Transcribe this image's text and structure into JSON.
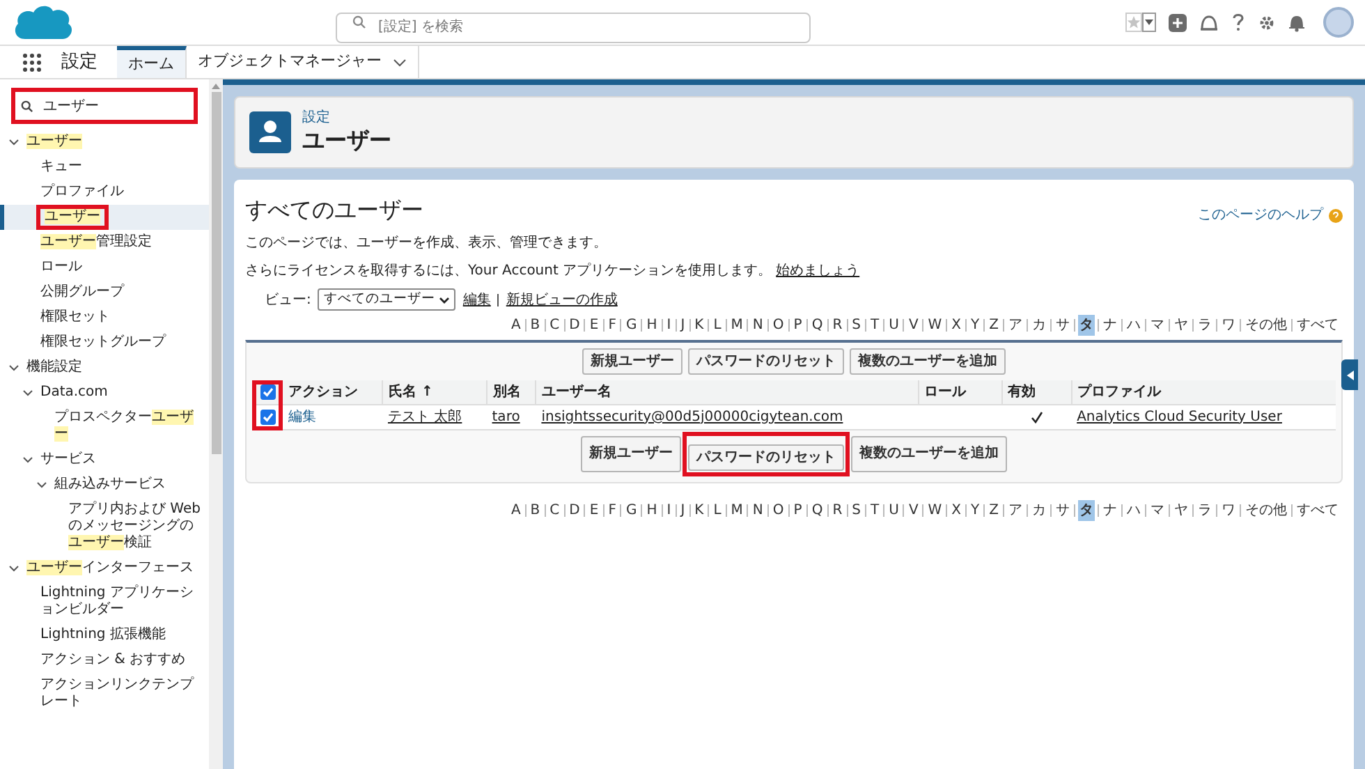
{
  "header": {
    "search": {
      "placeholder": "[設定] を検索"
    }
  },
  "nav": {
    "app_name": "設定",
    "tabs": [
      {
        "label": "ホーム",
        "selected": true,
        "dropdown": false
      },
      {
        "label": "オブジェクトマネージャー",
        "selected": false,
        "dropdown": true
      }
    ]
  },
  "sidebar": {
    "search": {
      "value": "ユーザー",
      "annotated": true
    },
    "items": [
      {
        "parts": [
          {
            "text": "ユーザー",
            "match": true
          }
        ],
        "expanded": true,
        "children": [
          {
            "parts": [
              {
                "text": "キュー",
                "match": false
              }
            ],
            "selected": false,
            "annotated": false
          },
          {
            "parts": [
              {
                "text": "プロファイル",
                "match": false
              }
            ],
            "selected": false,
            "annotated": false
          },
          {
            "parts": [
              {
                "text": "ユーザー",
                "match": true
              }
            ],
            "selected": true,
            "annotated": true
          },
          {
            "parts": [
              {
                "text": "ユーザー",
                "match": true
              },
              {
                "text": "管理設定",
                "match": false
              }
            ],
            "selected": false,
            "annotated": false
          },
          {
            "parts": [
              {
                "text": "ロール",
                "match": false
              }
            ],
            "selected": false,
            "annotated": false
          },
          {
            "parts": [
              {
                "text": "公開グループ",
                "match": false
              }
            ],
            "selected": false,
            "annotated": false
          },
          {
            "parts": [
              {
                "text": "権限セット",
                "match": false
              }
            ],
            "selected": false,
            "annotated": false
          },
          {
            "parts": [
              {
                "text": "権限セットグループ",
                "match": false
              }
            ],
            "selected": false,
            "annotated": false
          }
        ]
      },
      {
        "parts": [
          {
            "text": "機能設定",
            "match": false
          }
        ],
        "expanded": true,
        "children": [
          {
            "parts": [
              {
                "text": "Data.com",
                "match": false
              }
            ],
            "expanded": true,
            "children": [
              {
                "parts": [
                  {
                    "text": "プロスペクター",
                    "match": false
                  },
                  {
                    "text": "ユーザー",
                    "match": true
                  }
                ],
                "selected": false,
                "annotated": false
              }
            ]
          },
          {
            "parts": [
              {
                "text": "サービス",
                "match": false
              }
            ],
            "expanded": true,
            "children": [
              {
                "parts": [
                  {
                    "text": "組み込みサービス",
                    "match": false
                  }
                ],
                "expanded": true,
                "children": [
                  {
                    "parts": [
                      {
                        "text": "アプリ内および Web のメッセージングの",
                        "match": false
                      },
                      {
                        "text": "ユーザー",
                        "match": true
                      },
                      {
                        "text": "検証",
                        "match": false
                      }
                    ],
                    "selected": false,
                    "annotated": false
                  }
                ]
              }
            ]
          }
        ]
      },
      {
        "parts": [
          {
            "text": "ユーザー",
            "match": true
          },
          {
            "text": "インターフェース",
            "match": false
          }
        ],
        "expanded": true,
        "children": [
          {
            "parts": [
              {
                "text": "Lightning アプリケーションビルダー",
                "match": false
              }
            ],
            "selected": false,
            "annotated": false
          },
          {
            "parts": [
              {
                "text": "Lightning 拡張機能",
                "match": false
              }
            ],
            "selected": false,
            "annotated": false
          },
          {
            "parts": [
              {
                "text": "アクション & おすすめ",
                "match": false
              }
            ],
            "selected": false,
            "annotated": false
          },
          {
            "parts": [
              {
                "text": "アクションリンクテンプレート",
                "match": false
              }
            ],
            "selected": false,
            "annotated": false
          }
        ]
      }
    ]
  },
  "page_header": {
    "breadcrumb": "設定",
    "title": "ユーザー"
  },
  "content": {
    "title": "すべてのユーザー",
    "help_link": "このページのヘルプ",
    "description": "このページでは、ユーザーを作成、表示、管理できます。",
    "license_text": "さらにライセンスを取得するには、Your Account アプリケーションを使用します。",
    "license_link": "始めましょう",
    "view_label": "ビュー:",
    "view_value": "すべてのユーザー",
    "edit_link": "編集",
    "new_view_link": "新規ビューの作成",
    "letters": [
      {
        "label": "A",
        "selected": false
      },
      {
        "label": "B",
        "selected": false
      },
      {
        "label": "C",
        "selected": false
      },
      {
        "label": "D",
        "selected": false
      },
      {
        "label": "E",
        "selected": false
      },
      {
        "label": "F",
        "selected": false
      },
      {
        "label": "G",
        "selected": false
      },
      {
        "label": "H",
        "selected": false
      },
      {
        "label": "I",
        "selected": false
      },
      {
        "label": "J",
        "selected": false
      },
      {
        "label": "K",
        "selected": false
      },
      {
        "label": "L",
        "selected": false
      },
      {
        "label": "M",
        "selected": false
      },
      {
        "label": "N",
        "selected": false
      },
      {
        "label": "O",
        "selected": false
      },
      {
        "label": "P",
        "selected": false
      },
      {
        "label": "Q",
        "selected": false
      },
      {
        "label": "R",
        "selected": false
      },
      {
        "label": "S",
        "selected": false
      },
      {
        "label": "T",
        "selected": false
      },
      {
        "label": "U",
        "selected": false
      },
      {
        "label": "V",
        "selected": false
      },
      {
        "label": "W",
        "selected": false
      },
      {
        "label": "X",
        "selected": false
      },
      {
        "label": "Y",
        "selected": false
      },
      {
        "label": "Z",
        "selected": false
      },
      {
        "label": "ア",
        "selected": false
      },
      {
        "label": "カ",
        "selected": false
      },
      {
        "label": "サ",
        "selected": false
      },
      {
        "label": "タ",
        "selected": true
      },
      {
        "label": "ナ",
        "selected": false
      },
      {
        "label": "ハ",
        "selected": false
      },
      {
        "label": "マ",
        "selected": false
      },
      {
        "label": "ヤ",
        "selected": false
      },
      {
        "label": "ラ",
        "selected": false
      },
      {
        "label": "ワ",
        "selected": false
      },
      {
        "label": "その他",
        "selected": false
      },
      {
        "label": "すべて",
        "selected": false
      }
    ],
    "letters_bottom": [
      {
        "label": "A",
        "selected": false
      },
      {
        "label": "B",
        "selected": false
      },
      {
        "label": "C",
        "selected": false
      },
      {
        "label": "D",
        "selected": false
      },
      {
        "label": "E",
        "selected": false
      },
      {
        "label": "F",
        "selected": false
      },
      {
        "label": "G",
        "selected": false
      },
      {
        "label": "H",
        "selected": false
      },
      {
        "label": "I",
        "selected": false
      },
      {
        "label": "J",
        "selected": false
      },
      {
        "label": "K",
        "selected": false
      },
      {
        "label": "L",
        "selected": false
      },
      {
        "label": "M",
        "selected": false
      },
      {
        "label": "N",
        "selected": false
      },
      {
        "label": "O",
        "selected": false
      },
      {
        "label": "P",
        "selected": false
      },
      {
        "label": "Q",
        "selected": false
      },
      {
        "label": "R",
        "selected": false
      },
      {
        "label": "S",
        "selected": false
      },
      {
        "label": "T",
        "selected": false
      },
      {
        "label": "U",
        "selected": false
      },
      {
        "label": "V",
        "selected": false
      },
      {
        "label": "W",
        "selected": false
      },
      {
        "label": "X",
        "selected": false
      },
      {
        "label": "Y",
        "selected": false
      },
      {
        "label": "Z",
        "selected": false
      },
      {
        "label": "ア",
        "selected": false
      },
      {
        "label": "カ",
        "selected": false
      },
      {
        "label": "サ",
        "selected": false
      },
      {
        "label": "タ",
        "selected": true
      },
      {
        "label": "ナ",
        "selected": false
      },
      {
        "label": "ハ",
        "selected": false
      },
      {
        "label": "マ",
        "selected": false
      },
      {
        "label": "ヤ",
        "selected": false
      },
      {
        "label": "ラ",
        "selected": false
      },
      {
        "label": "ワ",
        "selected": false
      },
      {
        "label": "その他",
        "selected": false
      },
      {
        "label": "すべて",
        "selected": false
      }
    ],
    "buttons_top": [
      {
        "label": "新規ユーザー",
        "annotated": false
      },
      {
        "label": "パスワードのリセット",
        "annotated": false
      },
      {
        "label": "複数のユーザーを追加",
        "annotated": false
      }
    ],
    "buttons_bottom": [
      {
        "label": "新規ユーザー",
        "annotated": false
      },
      {
        "label": "パスワードのリセット",
        "annotated": true
      },
      {
        "label": "複数のユーザーを追加",
        "annotated": false
      }
    ],
    "table": {
      "select_all_checked": true,
      "checkbox_annotated": true,
      "columns": [
        "アクション",
        "氏名 ↑",
        "別名",
        "ユーザー名",
        "ロール",
        "有効",
        "プロファイル"
      ],
      "rows": [
        {
          "checked": true,
          "action": "編集",
          "name": "テスト 太郎",
          "alias": "taro",
          "username": "insightssecurity@00d5j00000cigytean.com",
          "active": true,
          "profile": "Analytics Cloud Security User"
        }
      ]
    }
  }
}
